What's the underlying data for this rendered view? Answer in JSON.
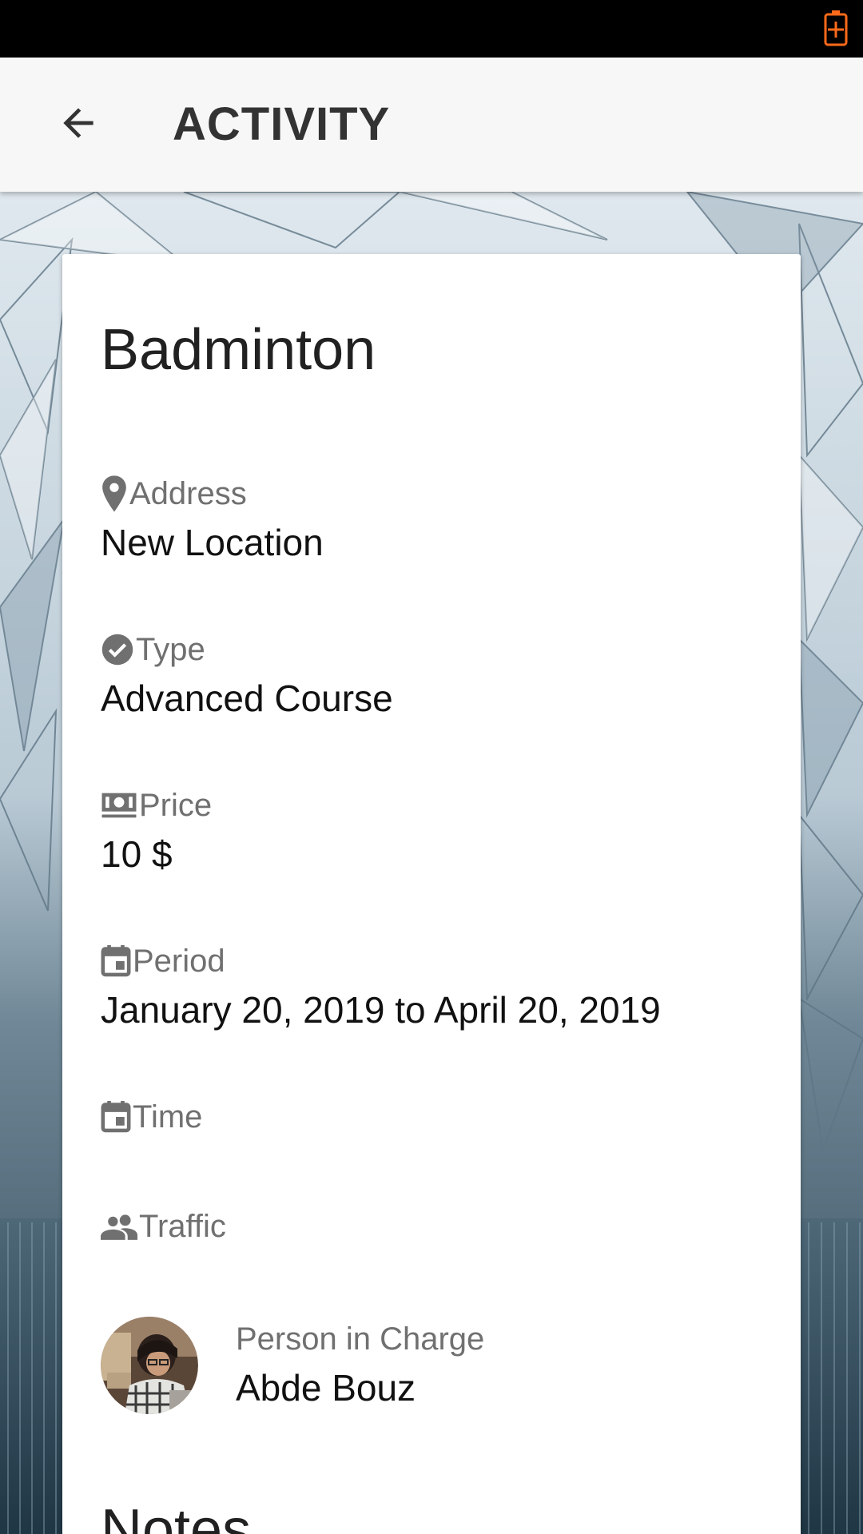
{
  "app_bar": {
    "title": "ACTIVITY"
  },
  "activity": {
    "title": "Badminton",
    "fields": {
      "address": {
        "label": "Address",
        "value": "New Location",
        "icon": "location-pin-icon"
      },
      "type": {
        "label": "Type",
        "value": "Advanced Course",
        "icon": "check-circle-icon"
      },
      "price": {
        "label": "Price",
        "value": "10 $",
        "icon": "cash-icon"
      },
      "period": {
        "label": "Period",
        "value": "January 20, 2019 to April 20, 2019",
        "icon": "calendar-icon"
      },
      "time": {
        "label": "Time",
        "value": "",
        "icon": "calendar-icon"
      },
      "traffic": {
        "label": "Traffic",
        "value": "",
        "icon": "people-icon"
      }
    },
    "person_in_charge": {
      "label": "Person in Charge",
      "name": "Abde Bouz"
    },
    "notes_heading": "Notes"
  },
  "colors": {
    "status_bar": "#000000",
    "battery": "#ff6a1a",
    "app_bar": "#f7f7f7",
    "label": "#707070",
    "value": "#111111"
  }
}
